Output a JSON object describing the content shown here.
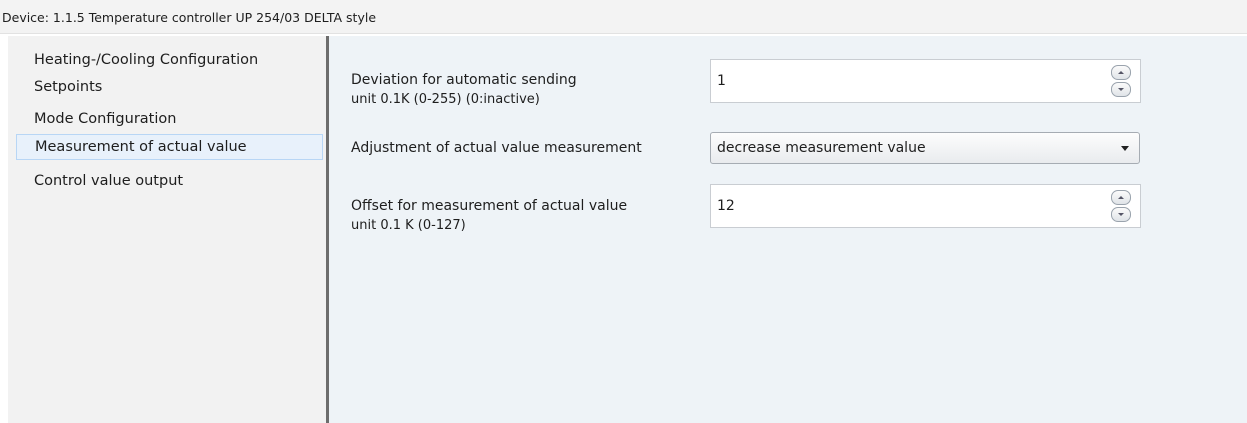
{
  "title_bar": {
    "text": "Device: 1.1.5  Temperature controller UP 254/03 DELTA style"
  },
  "nav": {
    "items": [
      {
        "label": "Heating-/Cooling  Configuration"
      },
      {
        "label": "Setpoints"
      },
      {
        "label": "Mode  Configuration"
      },
      {
        "label": "Measurement of actual value",
        "selected": true
      },
      {
        "label": "Control value output"
      }
    ]
  },
  "params": {
    "deviation": {
      "label_line1": "Deviation for automatic sending",
      "label_line2": "unit 0.1K  (0-255)  (0:inactive)",
      "value": "1"
    },
    "adjustment": {
      "label": "Adjustment of actual value measurement",
      "value": "decrease measurement value"
    },
    "offset": {
      "label_line1": "Offset for measurement of actual value",
      "label_line2": "unit 0.1 K (0-127)",
      "value": "12"
    }
  },
  "icons": {
    "spin_up": "chevron-up-icon",
    "spin_down": "chevron-down-icon",
    "dropdown": "caret-down-icon"
  },
  "colors": {
    "selection_bg": "#e8f1fb",
    "selection_border": "#b8d6f5",
    "content_bg": "#eef3f7",
    "splitter": "#6d6d6d"
  }
}
